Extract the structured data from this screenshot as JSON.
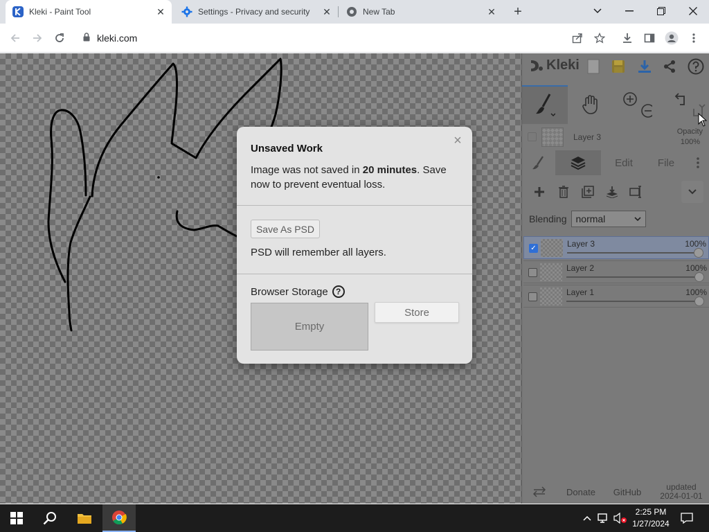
{
  "browser": {
    "tabs": [
      {
        "title": "Kleki - Paint Tool",
        "active": true
      },
      {
        "title": "Settings - Privacy and security",
        "active": false
      },
      {
        "title": "New Tab",
        "active": false
      }
    ],
    "url": "kleki.com"
  },
  "app": {
    "logo_text": "Kleki",
    "current_layer": "Layer 3",
    "opacity_label": "Opacity",
    "opacity_value": "100%",
    "panel_tabs": {
      "edit": "Edit",
      "file": "File"
    },
    "blending_label": "Blending",
    "blending_value": "normal",
    "layers": [
      {
        "name": "Layer 3",
        "opacity": "100%",
        "checked": true
      },
      {
        "name": "Layer 2",
        "opacity": "100%",
        "checked": false
      },
      {
        "name": "Layer 1",
        "opacity": "100%",
        "checked": false
      }
    ],
    "footer": {
      "donate": "Donate",
      "github": "GitHub",
      "updated_label": "updated",
      "updated_date": "2024-01-01"
    }
  },
  "dialog": {
    "title": "Unsaved Work",
    "msg_prefix": "Image was not saved in ",
    "msg_bold": "20 minutes",
    "msg_suffix": ". Save now to prevent eventual loss.",
    "save_psd": "Save As PSD",
    "psd_note": "PSD will remember all layers.",
    "storage_label": "Browser Storage",
    "help": "?",
    "storage_empty": "Empty",
    "store_button": "Store",
    "close": "×"
  },
  "taskbar": {
    "time": "2:25 PM",
    "date": "1/27/2024"
  },
  "colors": {
    "accent": "#3a6ca8",
    "selected_layer": "#7f8aa0",
    "checkbox_checked": "#2f6fd6"
  }
}
